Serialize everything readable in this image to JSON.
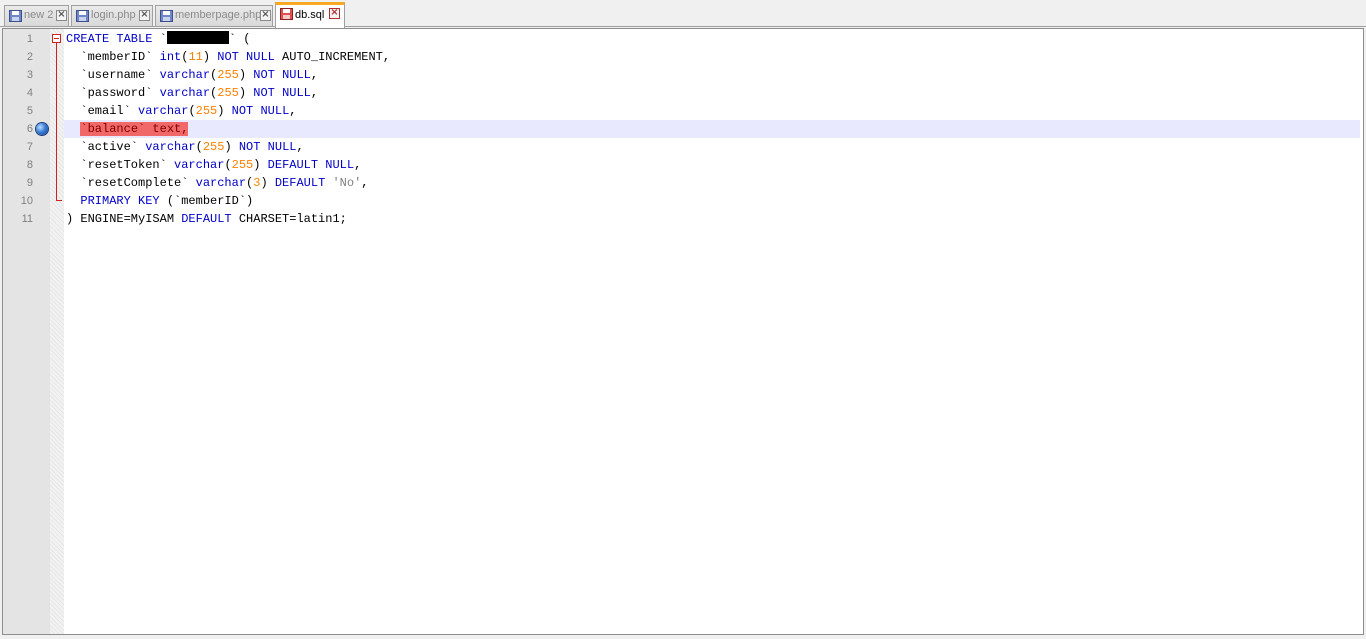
{
  "tabs": [
    {
      "label": "new 2",
      "icon": "save-disk-icon",
      "active": false
    },
    {
      "label": "login.php",
      "icon": "save-disk-icon",
      "active": false
    },
    {
      "label": "memberpage.php",
      "icon": "save-disk-icon",
      "active": false
    },
    {
      "label": "db.sql",
      "icon": "unsaved-disk-icon",
      "active": true
    }
  ],
  "editor": {
    "current_line": 6,
    "bookmark_line": 6,
    "colors": {
      "keyword": "#0000c8",
      "number": "#ff8000",
      "string": "#808080",
      "error_highlight": "#f06868",
      "current_line": "#e8e8ff",
      "fold_marker": "#d02020"
    },
    "lines": [
      {
        "num": "1",
        "tokens": [
          [
            "kw",
            "CREATE TABLE"
          ],
          [
            "text",
            " `"
          ],
          [
            "redact",
            ""
          ],
          [
            "text",
            "` ("
          ]
        ]
      },
      {
        "num": "2",
        "tokens": [
          [
            "text",
            "  `memberID` "
          ],
          [
            "kw",
            "int"
          ],
          [
            "text",
            "("
          ],
          [
            "num",
            "11"
          ],
          [
            "text",
            ") "
          ],
          [
            "kw",
            "NOT NULL"
          ],
          [
            "text",
            " AUTO_INCREMENT,"
          ]
        ]
      },
      {
        "num": "3",
        "tokens": [
          [
            "text",
            "  `username` "
          ],
          [
            "kw",
            "varchar"
          ],
          [
            "text",
            "("
          ],
          [
            "num",
            "255"
          ],
          [
            "text",
            ") "
          ],
          [
            "kw",
            "NOT NULL"
          ],
          [
            "text",
            ","
          ]
        ]
      },
      {
        "num": "4",
        "tokens": [
          [
            "text",
            "  `password` "
          ],
          [
            "kw",
            "varchar"
          ],
          [
            "text",
            "("
          ],
          [
            "num",
            "255"
          ],
          [
            "text",
            ") "
          ],
          [
            "kw",
            "NOT NULL"
          ],
          [
            "text",
            ","
          ]
        ]
      },
      {
        "num": "5",
        "tokens": [
          [
            "text",
            "  `email` "
          ],
          [
            "kw",
            "varchar"
          ],
          [
            "text",
            "("
          ],
          [
            "num",
            "255"
          ],
          [
            "text",
            ") "
          ],
          [
            "kw",
            "NOT NULL"
          ],
          [
            "text",
            ","
          ]
        ]
      },
      {
        "num": "6",
        "tokens": [
          [
            "text",
            "  "
          ],
          [
            "err",
            "`balance` text,"
          ]
        ]
      },
      {
        "num": "7",
        "tokens": [
          [
            "text",
            "  `active` "
          ],
          [
            "kw",
            "varchar"
          ],
          [
            "text",
            "("
          ],
          [
            "num",
            "255"
          ],
          [
            "text",
            ") "
          ],
          [
            "kw",
            "NOT NULL"
          ],
          [
            "text",
            ","
          ]
        ]
      },
      {
        "num": "8",
        "tokens": [
          [
            "text",
            "  `resetToken` "
          ],
          [
            "kw",
            "varchar"
          ],
          [
            "text",
            "("
          ],
          [
            "num",
            "255"
          ],
          [
            "text",
            ") "
          ],
          [
            "kw",
            "DEFAULT NULL"
          ],
          [
            "text",
            ","
          ]
        ]
      },
      {
        "num": "9",
        "tokens": [
          [
            "text",
            "  `resetComplete` "
          ],
          [
            "kw",
            "varchar"
          ],
          [
            "text",
            "("
          ],
          [
            "num",
            "3"
          ],
          [
            "text",
            ") "
          ],
          [
            "kw",
            "DEFAULT"
          ],
          [
            "text",
            " "
          ],
          [
            "str",
            "'No'"
          ],
          [
            "text",
            ","
          ]
        ]
      },
      {
        "num": "10",
        "tokens": [
          [
            "text",
            "  "
          ],
          [
            "kw",
            "PRIMARY KEY"
          ],
          [
            "text",
            " (`memberID`)"
          ]
        ]
      },
      {
        "num": "11",
        "tokens": [
          [
            "text",
            ") ENGINE=MyISAM "
          ],
          [
            "kw",
            "DEFAULT"
          ],
          [
            "text",
            " CHARSET=latin1;"
          ]
        ]
      }
    ]
  }
}
